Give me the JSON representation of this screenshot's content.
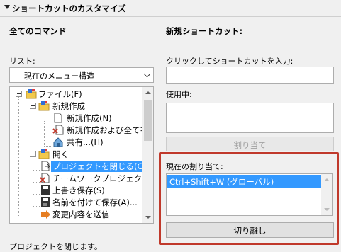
{
  "header": {
    "title": "ショートカットのカスタマイズ"
  },
  "left": {
    "all_commands": "全てのコマンド",
    "list_label": "リスト:",
    "list_select": "現在のメニュー構造",
    "tree": [
      {
        "label": "ファイル(F)",
        "icon": "folder-menu-icon"
      },
      {
        "label": "新規作成",
        "icon": "folder-menu-icon"
      },
      {
        "label": "新規作成(N)",
        "icon": "new-document-icon"
      },
      {
        "label": "新規作成および全てを",
        "icon": "new-reset-icon"
      },
      {
        "label": "共有...(H)",
        "icon": "share-icon"
      },
      {
        "label": "開く",
        "icon": "folder-menu-icon"
      },
      {
        "label": "プロジェクトを閉じる(C)",
        "icon": "close-project-icon"
      },
      {
        "label": "チームワークプロジェクトから",
        "icon": "teamwork-icon"
      },
      {
        "label": "上書き保存(S)",
        "icon": "save-icon"
      },
      {
        "label": "名前を付けて保存(A)...",
        "icon": "save-as-icon"
      },
      {
        "label": "変更内容を送信",
        "icon": "send-changes-icon"
      }
    ]
  },
  "right": {
    "new_shortcut": "新規ショートカット:",
    "click_label": "クリックしてショートカットを入力:",
    "in_use_label": "使用中:",
    "assign_button": "割り当て",
    "current_label": "現在の割り当て:",
    "current_assignment": "Ctrl+Shift+W (グローバル)",
    "detach_button": "切り離し"
  },
  "status": {
    "text": "プロジェクトを閉じます。"
  },
  "colors": {
    "selection": "#3399ff",
    "highlight_border": "#c0392b"
  }
}
